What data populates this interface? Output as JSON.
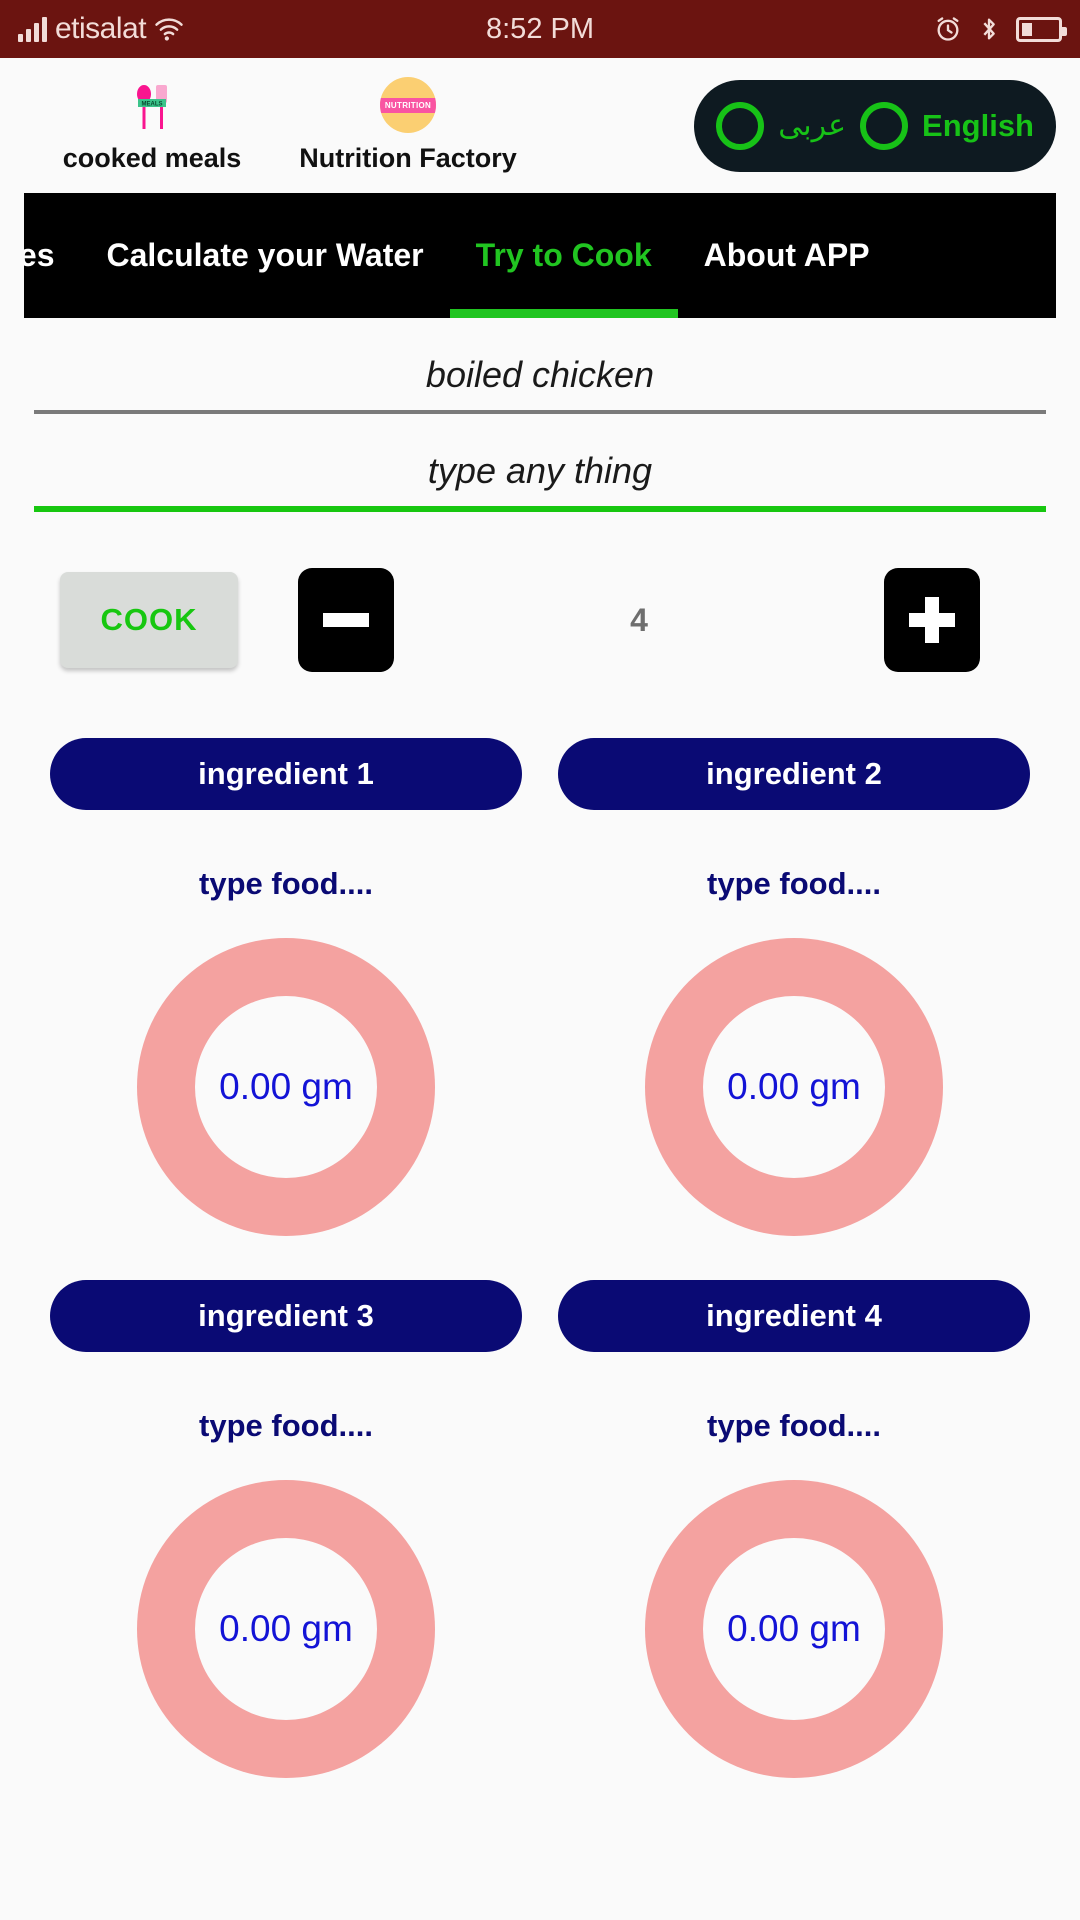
{
  "status_bar": {
    "carrier": "etisalat",
    "time": "8:52 PM",
    "icons": [
      "signal-icon",
      "wifi-icon",
      "alarm-icon",
      "bluetooth-icon",
      "battery-icon"
    ],
    "background_color": "#6b1410"
  },
  "top_bar": {
    "shortcuts": [
      {
        "label": "cooked meals",
        "icon": "meals-icon",
        "icon_text": "MEALS"
      },
      {
        "label": "Nutrition Factory",
        "icon": "nutrition-icon",
        "icon_text": "NUTRITION"
      }
    ],
    "language_toggle": {
      "arabic_label": "عربى",
      "english_label": "English",
      "accent_color": "#17c217",
      "background_color": "#0e1a21"
    }
  },
  "tabs": {
    "items": [
      {
        "label": "ories",
        "active": false
      },
      {
        "label": "Calculate your Water",
        "active": false
      },
      {
        "label": "Try to Cook",
        "active": true
      },
      {
        "label": "About APP",
        "active": false
      }
    ],
    "active_color": "#21c521",
    "background_color": "#000000"
  },
  "fields": [
    {
      "value": "boiled chicken",
      "underline_color": "#7a7a7a",
      "focused": false
    },
    {
      "value": "type any thing",
      "underline_color": "#17c710",
      "focused": true
    }
  ],
  "controls": {
    "cook_label": "COOK",
    "minus_label": "−",
    "plus_label": "+",
    "counter_value": "4",
    "cook_text_color": "#17c710"
  },
  "ingredients": [
    {
      "button_label": "ingredient 1",
      "sub_label": "type food....",
      "value": "0.00 gm"
    },
    {
      "button_label": "ingredient 2",
      "sub_label": "type food....",
      "value": "0.00 gm"
    },
    {
      "button_label": "ingredient 3",
      "sub_label": "type food....",
      "value": "0.00 gm"
    },
    {
      "button_label": "ingredient 4",
      "sub_label": "type food....",
      "value": "0.00 gm"
    }
  ],
  "theme": {
    "navy": "#0a0a74",
    "donut_ring": "#f4a2a0",
    "value_color": "#1313d6",
    "page_background": "#fafafa"
  }
}
